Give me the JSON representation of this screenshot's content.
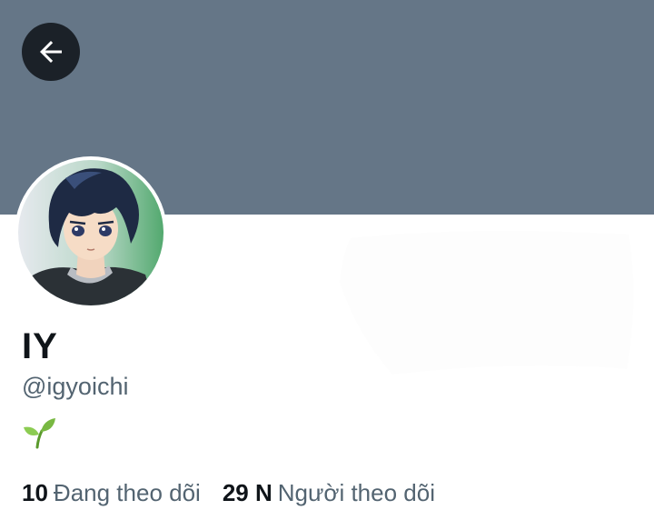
{
  "profile": {
    "display_name": "IY",
    "handle": "@igyoichi",
    "bio_emoji_icon": "seedling-icon",
    "avatar_icon": "anime-avatar",
    "banner_color": "#657687",
    "stats": {
      "following_count": "10",
      "following_label": "Đang theo dõi",
      "followers_count": "29 N",
      "followers_label": "Người theo dõi"
    }
  },
  "navigation": {
    "back_icon": "arrow-left-icon"
  },
  "colors": {
    "primary_text": "#0f1419",
    "secondary_text": "#536471",
    "back_button_bg": "#1b2128"
  }
}
